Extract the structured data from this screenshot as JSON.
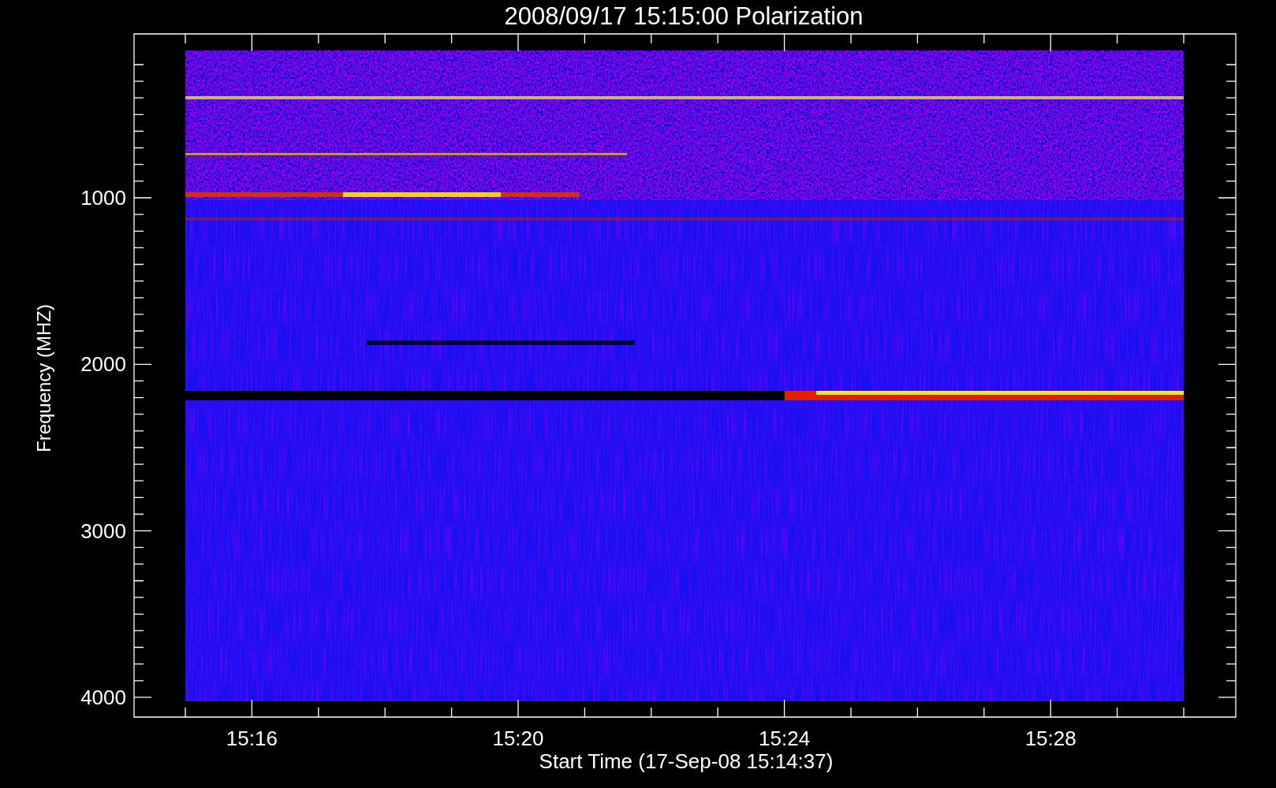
{
  "plot": {
    "title": "2008/09/17 15:15:00 Polarization",
    "ylabel": "Frequency (MHZ)",
    "xlabel": "Start Time (17-Sep-08 15:14:37)",
    "yticks": [
      "1000",
      "2000",
      "3000",
      "4000"
    ],
    "xticks": [
      "15:16",
      "15:20",
      "15:24",
      "15:28"
    ]
  }
}
